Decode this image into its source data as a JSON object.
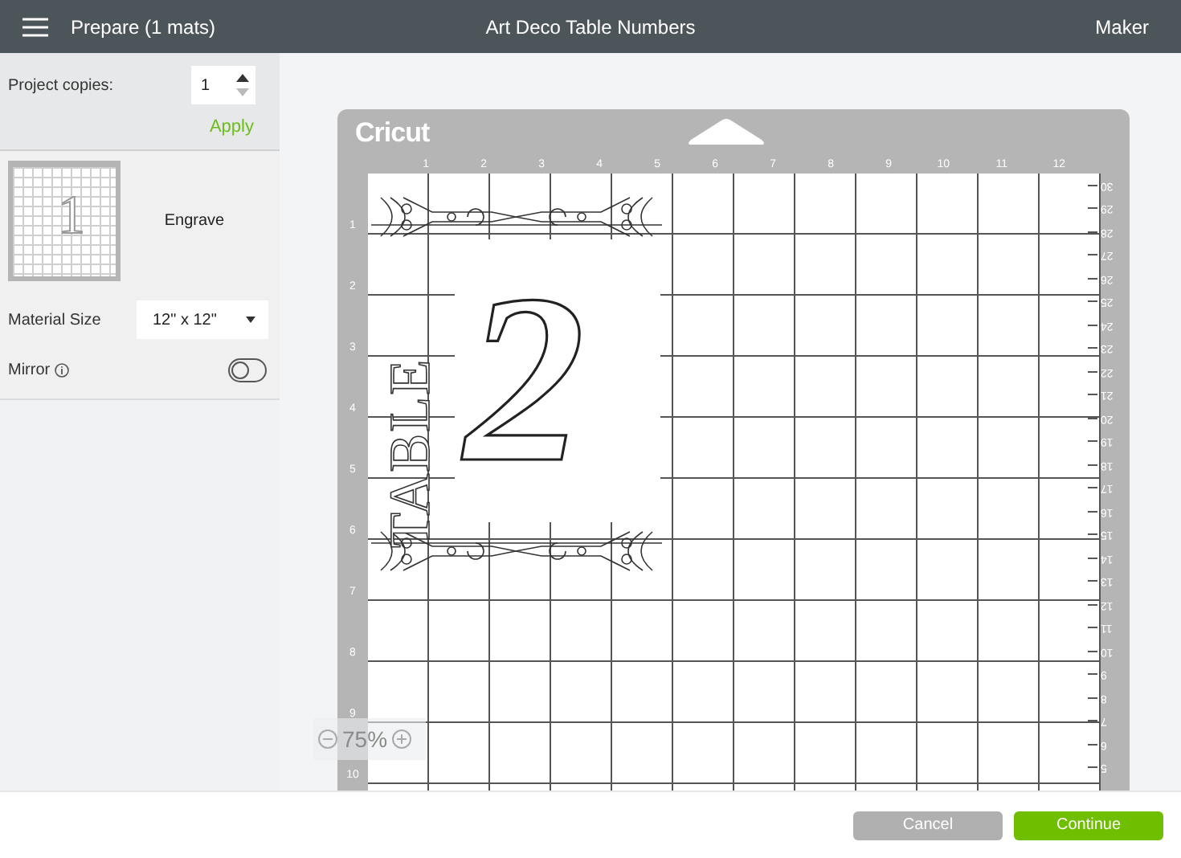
{
  "header": {
    "title": "Prepare (1 mats)",
    "project_name": "Art Deco Table Numbers",
    "machine": "Maker"
  },
  "copies": {
    "label": "Project copies:",
    "value": "1",
    "apply": "Apply"
  },
  "mats": [
    {
      "thumbnail_number": "1",
      "operation": "Engrave",
      "material_size_label": "Material Size",
      "material_size": "12\" x 12\"",
      "mirror_label": "Mirror",
      "mirror": false
    }
  ],
  "mat": {
    "brand": "Cricut",
    "top_ruler": [
      "1",
      "2",
      "3",
      "4",
      "5",
      "6",
      "7",
      "8",
      "9",
      "10",
      "11",
      "12"
    ],
    "left_ruler": [
      "1",
      "2",
      "3",
      "4",
      "5",
      "6",
      "7",
      "8",
      "9",
      "10"
    ],
    "right_ruler": [
      "30",
      "29",
      "28",
      "27",
      "26",
      "25",
      "24",
      "23",
      "22",
      "21",
      "20",
      "19",
      "18",
      "17",
      "16",
      "15",
      "14",
      "13",
      "12",
      "11",
      "10",
      "9",
      "8",
      "7",
      "6",
      "5"
    ],
    "design": {
      "word": "TABLE",
      "number": "2"
    }
  },
  "zoom": {
    "value": "75%"
  },
  "footer": {
    "buttons": [
      {
        "label": "Cancel",
        "kind": "secondary"
      },
      {
        "label": "Continue",
        "kind": "primary"
      }
    ]
  }
}
